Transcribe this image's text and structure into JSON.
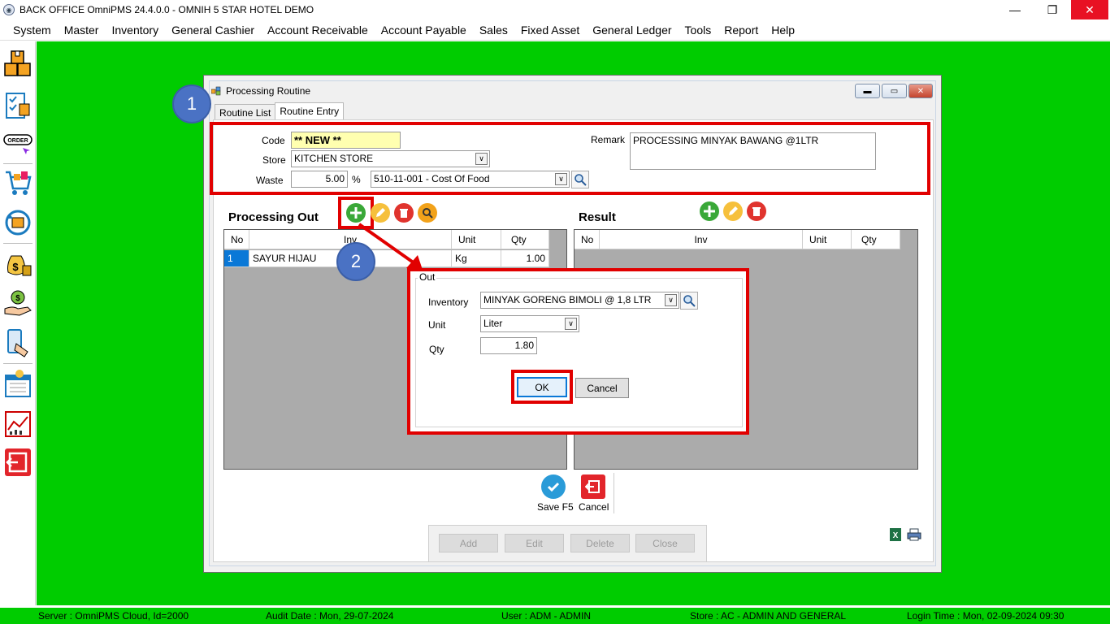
{
  "window": {
    "title": "BACK OFFICE OmniPMS 24.4.0.0 - OMNIH 5 STAR HOTEL DEMO",
    "min_glyph": "—",
    "max_glyph": "❐",
    "close_glyph": "✕"
  },
  "menu": [
    "System",
    "Master",
    "Inventory",
    "General Cashier",
    "Account Receivable",
    "Account Payable",
    "Sales",
    "Fixed Asset",
    "General Ledger",
    "Tools",
    "Report",
    "Help"
  ],
  "sidebar_icons": [
    "inventory-boxes-icon",
    "checklist-icon",
    "order-icon",
    "cart-icon",
    "sync-icon",
    "money-bag-icon",
    "cash-hand-icon",
    "mobile-payment-icon",
    "calendar-report-icon",
    "chart-report-icon",
    "exit-icon"
  ],
  "status": {
    "server": "Server : OmniPMS Cloud, Id=2000",
    "audit": "Audit Date : Mon, 29-07-2024",
    "user": "User : ADM - ADMIN",
    "store": "Store : AC - ADMIN AND GENERAL",
    "login": "Login Time : Mon, 02-09-2024 09:30"
  },
  "form": {
    "title": "Processing Routine",
    "tabs": [
      "Routine List",
      "Routine Entry"
    ],
    "active_tab": "Routine Entry",
    "code_label": "Code",
    "code_value": "** NEW **",
    "store_label": "Store",
    "store_value": "KITCHEN STORE",
    "waste_label": "Waste",
    "waste_value": "5.00",
    "waste_unit": "%",
    "waste_account": "510-11-001 - Cost Of Food",
    "remark_label": "Remark",
    "remark_value": "PROCESSING MINYAK BAWANG @1LTR"
  },
  "processing_out": {
    "title": "Processing Out",
    "columns": [
      "No",
      "Inv",
      "Unit",
      "Qty"
    ],
    "rows": [
      {
        "no": "1",
        "inv": "SAYUR HIJAU",
        "unit": "Kg",
        "qty": "1.00"
      }
    ]
  },
  "result": {
    "title": "Result",
    "columns": [
      "No",
      "Inv",
      "Unit",
      "Qty"
    ]
  },
  "dialog": {
    "group_label": "Out",
    "inventory_label": "Inventory",
    "inventory_value": "MINYAK GORENG BIMOLI @ 1,8 LTR",
    "unit_label": "Unit",
    "unit_value": "Liter",
    "qty_label": "Qty",
    "qty_value": "1.80",
    "ok": "OK",
    "cancel": "Cancel"
  },
  "actions": {
    "save": "Save F5",
    "cancel": "Cancel"
  },
  "bottom_buttons": [
    "Add",
    "Edit",
    "Delete",
    "Close"
  ],
  "annotations": [
    "1",
    "2"
  ],
  "colors": {
    "desktop": "#00cc00",
    "highlight": "#e10000",
    "badge": "#4a72c4"
  }
}
